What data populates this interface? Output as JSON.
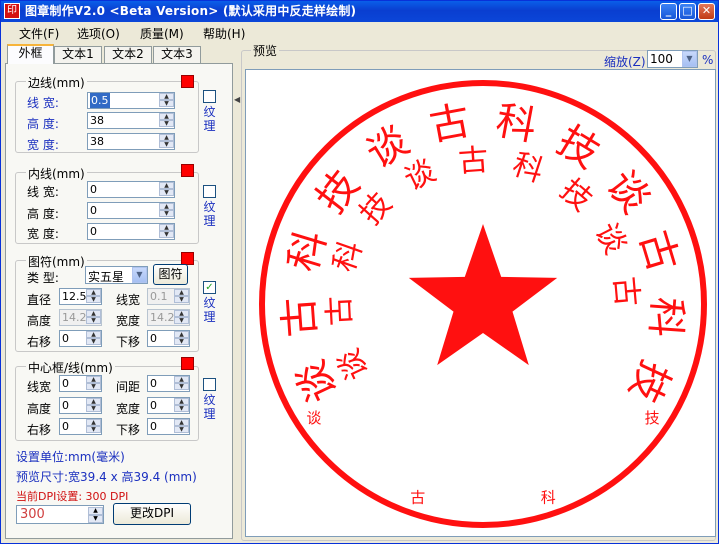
{
  "window": {
    "title": "图章制作V2.0 <Beta Version> (默认采用中反走样绘制)",
    "app_icon": "stamp-app-icon",
    "icon_label": "印"
  },
  "menu": [
    {
      "label": "文件(F)"
    },
    {
      "label": "选项(O)"
    },
    {
      "label": "质量(M)"
    },
    {
      "label": "帮助(H)"
    }
  ],
  "tabs": [
    {
      "label": "外框",
      "active": true
    },
    {
      "label": "文本1"
    },
    {
      "label": "文本2"
    },
    {
      "label": "文本3"
    }
  ],
  "border_group": {
    "title": "边线(mm)",
    "line_width_label": "线  宽:",
    "line_width": "0.5",
    "height_label": "高  度:",
    "height": "38",
    "width_label": "宽  度:",
    "width": "38",
    "texture_label": "纹理",
    "texture_checked": false,
    "color": "#ff0000"
  },
  "inner_group": {
    "title": "内线(mm)",
    "line_width_label": "线  宽:",
    "line_width": "0",
    "height_label": "高  度:",
    "height": "0",
    "width_label": "宽  度:",
    "width": "0",
    "texture_label": "纹理",
    "texture_checked": false,
    "color": "#ff0000"
  },
  "symbol_group": {
    "title": "图符(mm)",
    "type_label": "类  型:",
    "type_value": "实五星",
    "symbol_button": "图符",
    "diameter_label": "直径",
    "diameter": "12.5",
    "linewidth_label": "线宽",
    "linewidth": "0.1",
    "height_label": "高度",
    "height": "14.2",
    "width_label": "宽度",
    "width": "14.2",
    "right_label": "右移",
    "right": "0",
    "down_label": "下移",
    "down": "0",
    "texture_label": "纹理",
    "texture_checked": true,
    "check_mark": "✓",
    "color": "#ff0000"
  },
  "center_group": {
    "title": "中心框/线(mm)",
    "linewidth_label": "线宽",
    "linewidth": "0",
    "spacing_label": "间距",
    "spacing": "0",
    "height_label": "高度",
    "height": "0",
    "width_label": "宽度",
    "width": "0",
    "right_label": "右移",
    "right": "0",
    "down_label": "下移",
    "down": "0",
    "texture_label": "纹理",
    "texture_checked": false,
    "color": "#ff0000"
  },
  "status": {
    "unit": "设置单位:mm(毫米)",
    "preview_size": "预览尺寸:宽39.4 x 高39.4 (mm)",
    "current_dpi": "当前DPI设置: 300 DPI",
    "dpi_value": "300",
    "change_dpi_button": "更改DPI"
  },
  "preview": {
    "title": "预览",
    "zoom_label": "缩放(Z)",
    "zoom_value": "100",
    "zoom_unit": "%"
  },
  "stamp": {
    "ink_color": "#ff1010",
    "outer_text": "谈古科技谈古科技谈古科技",
    "inner_text": "谈古科技谈古科技谈古",
    "bottom_text": "谈古科技"
  }
}
